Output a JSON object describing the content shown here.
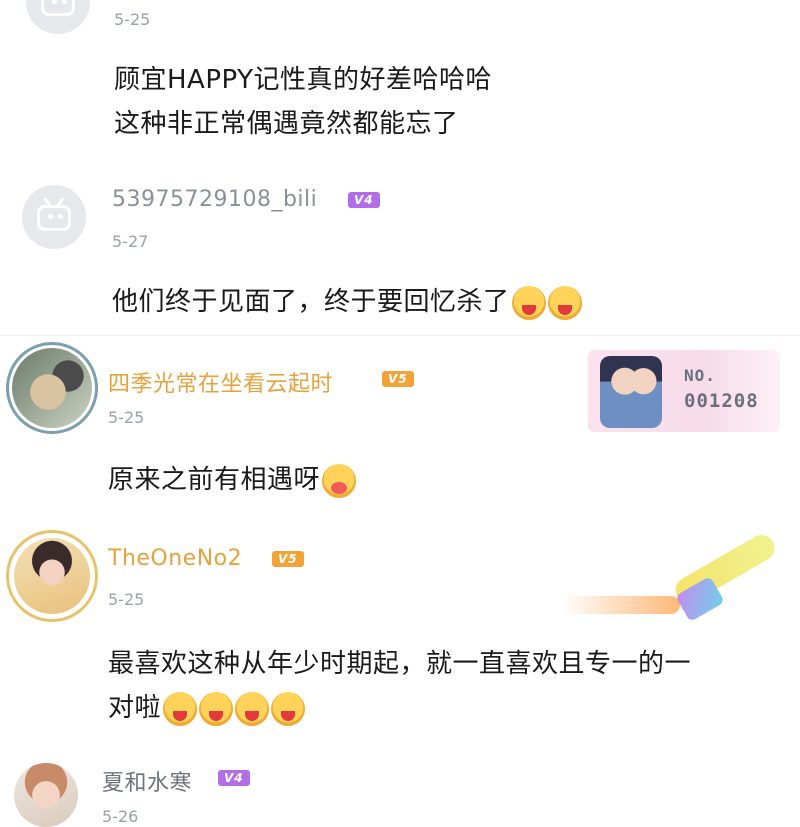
{
  "comments": [
    {
      "date": "5-25",
      "lines": [
        "顾宜HAPPY记性真的好差哈哈哈",
        "这种非正常偶遇竟然都能忘了"
      ]
    },
    {
      "username": "53975729108_bili",
      "level": "V4",
      "date": "5-27",
      "text": "他们终于见面了，终于要回忆杀了",
      "emojis": [
        "crying-face",
        "crying-face"
      ]
    },
    {
      "username": "四季光常在坐看云起时",
      "level": "V5",
      "date": "5-25",
      "text": "原来之前有相遇呀",
      "emojis": [
        "hug-face"
      ],
      "fan_card": {
        "label": "NO.",
        "number": "001208"
      }
    },
    {
      "username": "TheOneNo2",
      "level": "V5",
      "date": "5-25",
      "lines": [
        "最喜欢这种从年少时期起，就一直喜欢且专一的一",
        "对啦"
      ],
      "emojis": [
        "crying-face",
        "crying-face",
        "crying-face",
        "crying-face"
      ]
    },
    {
      "username": "夏和水寒",
      "level": "V4",
      "date": "5-26"
    }
  ],
  "colors": {
    "gold_name": "#e8a23b",
    "gray_name": "#8a8f99",
    "level_purple": "#b26ee8",
    "level_gold": "#f2a338",
    "date_gray": "#9aa0aa"
  }
}
